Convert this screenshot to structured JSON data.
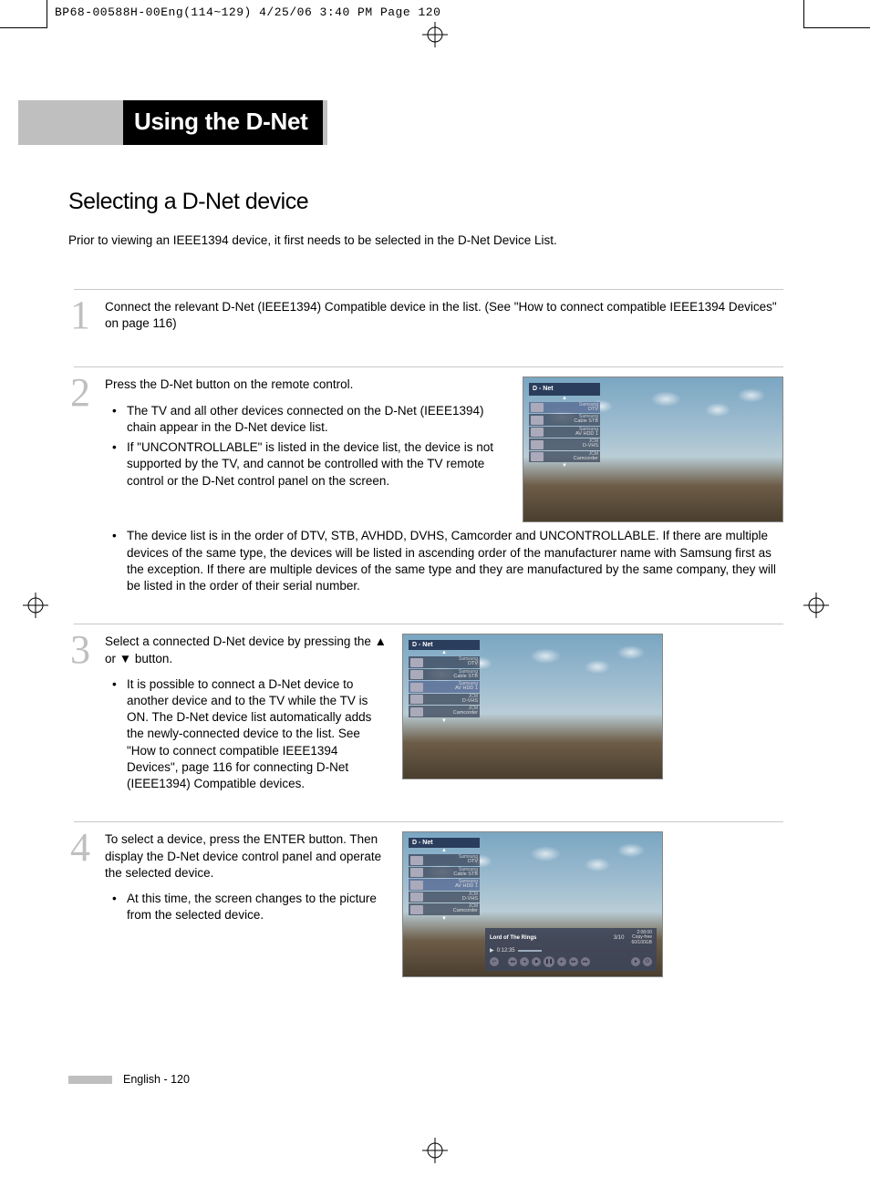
{
  "printHeader": "BP68-00588H-00Eng(114~129)  4/25/06  3:40 PM  Page 120",
  "pageTitle": "Using the D-Net",
  "sectionTitle": "Selecting a D-Net device",
  "intro": "Prior to viewing an IEEE1394 device, it first needs to be selected in the D-Net Device List.",
  "steps": {
    "1": {
      "num": "1",
      "text": "Connect the relevant D-Net (IEEE1394) Compatible device in the list. (See \"How to connect compatible IEEE1394 Devices\" on page 116)"
    },
    "2": {
      "num": "2",
      "text": "Press the D-Net button on the remote control.",
      "bullets": [
        "The TV and all other devices connected on the D-Net (IEEE1394) chain appear in the D-Net device list.",
        "If \"UNCONTROLLABLE\" is listed in the device list, the device is not supported by the TV, and cannot be controlled with the TV remote control or the D-Net control panel on the screen.",
        "The device list is in the order of DTV, STB, AVHDD, DVHS, Camcorder and UNCONTROLLABLE. If there are multiple devices of the same type, the devices will be listed in ascending order of the manufacturer name with Samsung first as the exception. If there are multiple devices of the same type and they are manufactured by the same company, they will be listed in the order of their serial number."
      ]
    },
    "3": {
      "num": "3",
      "text": "Select a connected D-Net device by pressing the ▲ or ▼ button.",
      "bullets": [
        "It is possible to connect a D-Net device to another device and to the TV while the TV is ON. The D-Net device list automatically adds the newly-connected device to the list. See \"How to connect compatible IEEE1394 Devices\", page 116 for connecting D-Net (IEEE1394) Compatible devices."
      ]
    },
    "4": {
      "num": "4",
      "text": "To select a device, press the ENTER button. Then display the D-Net device control panel and operate the selected device.",
      "bullets": [
        "At this time, the screen changes to the picture from the selected device."
      ]
    }
  },
  "tvUi": {
    "header": "D - Net",
    "devices": [
      {
        "mfr": "Samsung",
        "dev": "DTV"
      },
      {
        "mfr": "Samsung",
        "dev": "Cable STB"
      },
      {
        "mfr": "Samsung",
        "dev": "AV HDD 1"
      },
      {
        "mfr": "JCM",
        "dev": "D-VHS"
      },
      {
        "mfr": "JCM",
        "dev": "Camcorder"
      }
    ],
    "playback": {
      "title": "Lord of The Rings",
      "index": "3/10",
      "duration": "2:08:00",
      "copy": "Copy-free",
      "storage": "60/100GB",
      "elapsed": "0:12:35"
    }
  },
  "footer": "English - 120"
}
